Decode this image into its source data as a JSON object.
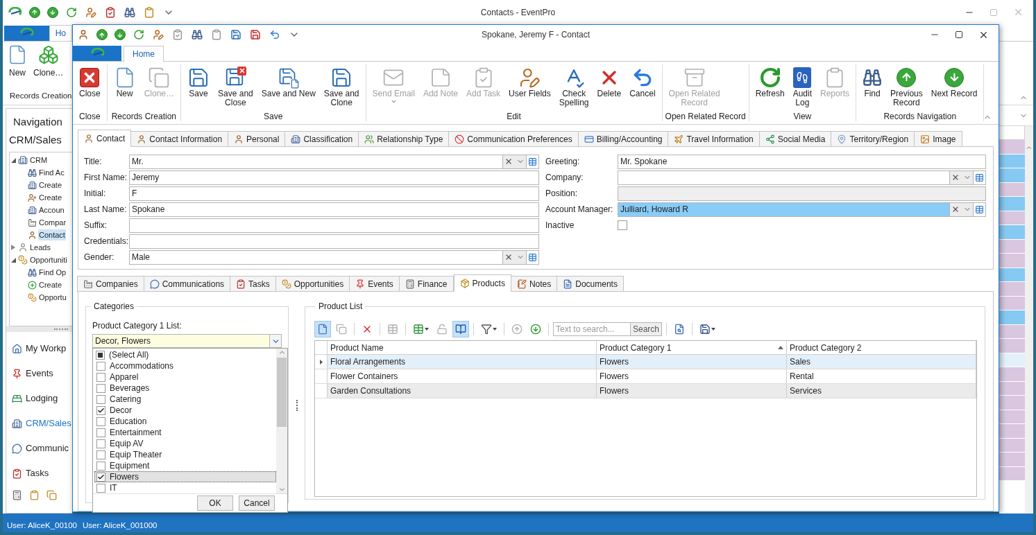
{
  "bg_window": {
    "title": "Contacts - EventPro",
    "tab": {
      "label": "Ho",
      "selected": true
    },
    "ribbon_buttons": [
      {
        "label": "New",
        "disabled": false
      },
      {
        "label": "Clone…",
        "disabled": false
      }
    ],
    "ribbon_group": "Records Creation",
    "navigation": {
      "title": "Navigation",
      "section": "CRM/Sales",
      "tree": [
        {
          "label": "CRM",
          "expanded": true,
          "selected": false,
          "children": [
            {
              "label": "Find Ac",
              "selected": false
            },
            {
              "label": "Create",
              "selected": false
            },
            {
              "label": "Create",
              "selected": false
            },
            {
              "label": "Accoun",
              "selected": false
            },
            {
              "label": "Compar",
              "selected": false
            },
            {
              "label": "Contact",
              "selected": true
            }
          ]
        },
        {
          "label": "Leads",
          "expanded": false,
          "selected": false
        },
        {
          "label": "Opportuniti",
          "expanded": true,
          "selected": false,
          "children": [
            {
              "label": "Find Op",
              "selected": false
            },
            {
              "label": "Create",
              "selected": false
            },
            {
              "label": "Opportu",
              "selected": false
            }
          ]
        }
      ]
    },
    "nav_buttons": [
      {
        "label": "My Workp",
        "selected": false
      },
      {
        "label": "Events",
        "selected": false
      },
      {
        "label": "Lodging",
        "selected": false
      },
      {
        "label": "CRM/Sales",
        "selected": true
      },
      {
        "label": "Communic",
        "selected": false
      },
      {
        "label": "Tasks",
        "selected": false
      }
    ],
    "status": [
      "User: AliceK_00100",
      "User: AliceK_001000"
    ],
    "grid_rows": [
      {
        "color": "#d9c6df"
      },
      {
        "color": "#86c9f3"
      },
      {
        "color": "#86c9f3"
      },
      {
        "color": "#d9c6df"
      },
      {
        "color": "#86c9f3"
      },
      {
        "color": "#d9c6df"
      },
      {
        "color": "#86c9f3"
      },
      {
        "color": "#d9c6df"
      },
      {
        "color": "#d9c6df"
      },
      {
        "color": "#86c9f3"
      },
      {
        "color": "#d9c6df"
      },
      {
        "color": "#d9c6df"
      },
      {
        "color": "#86c9f3"
      },
      {
        "color": "#d9c6df"
      },
      {
        "color": "#d9c6df"
      },
      {
        "color": "#e3f1fb"
      },
      {
        "color": "#d9c6df"
      },
      {
        "color": "#d9c6df"
      },
      {
        "color": "#d9c6df"
      },
      {
        "color": "#d9c6df"
      },
      {
        "color": "#d9c6df"
      },
      {
        "color": "#d9c6df"
      },
      {
        "color": "#d9c6df"
      },
      {
        "color": "#d9c6df"
      }
    ]
  },
  "dialog": {
    "title": "Spokane, Jeremy F - Contact",
    "ribbon_tabs": [
      {
        "label": "Home",
        "selected": true
      }
    ],
    "ribbon_groups": [
      {
        "label": "Close",
        "buttons": [
          {
            "label": "Close",
            "disabled": false,
            "menu": false
          }
        ]
      },
      {
        "label": "Records Creation",
        "buttons": [
          {
            "label": "New",
            "disabled": false,
            "menu": false
          },
          {
            "label": "Clone…",
            "disabled": true,
            "menu": false
          }
        ]
      },
      {
        "label": "Save",
        "buttons": [
          {
            "label": "Save",
            "disabled": false,
            "menu": false
          },
          {
            "label": "Save and\nClose",
            "disabled": false,
            "menu": false
          },
          {
            "label": "Save and New",
            "disabled": false,
            "menu": false
          },
          {
            "label": "Save and\nClone",
            "disabled": false,
            "menu": false
          }
        ]
      },
      {
        "label": "Edit",
        "buttons": [
          {
            "label": "Send Email",
            "disabled": true,
            "menu": true
          },
          {
            "label": "Add Note",
            "disabled": true,
            "menu": false
          },
          {
            "label": "Add Task",
            "disabled": true,
            "menu": false
          },
          {
            "label": "User Fields",
            "disabled": false,
            "menu": false
          },
          {
            "label": "Check\nSpelling",
            "disabled": false,
            "menu": false
          },
          {
            "label": "Delete",
            "disabled": false,
            "menu": false
          },
          {
            "label": "Cancel",
            "disabled": false,
            "menu": false
          }
        ]
      },
      {
        "label": "Open Related Record",
        "buttons": [
          {
            "label": "Open Related\nRecord",
            "disabled": true,
            "menu": false
          }
        ]
      },
      {
        "label": "View",
        "buttons": [
          {
            "label": "Refresh",
            "disabled": false,
            "menu": false
          },
          {
            "label": "Audit\nLog",
            "disabled": false,
            "menu": false
          },
          {
            "label": "Reports",
            "disabled": true,
            "menu": false
          }
        ]
      },
      {
        "label": "Records Navigation",
        "buttons": [
          {
            "label": "Find",
            "disabled": false,
            "menu": false
          },
          {
            "label": "Previous\nRecord",
            "disabled": false,
            "menu": false
          },
          {
            "label": "Next Record",
            "disabled": false,
            "menu": false
          }
        ]
      }
    ],
    "form_tabs": [
      {
        "label": "Contact",
        "selected": true
      },
      {
        "label": "Contact Information",
        "selected": false
      },
      {
        "label": "Personal",
        "selected": false
      },
      {
        "label": "Classification",
        "selected": false
      },
      {
        "label": "Relationship Type",
        "selected": false
      },
      {
        "label": "Communication Preferences",
        "selected": false
      },
      {
        "label": "Billing/Accounting",
        "selected": false
      },
      {
        "label": "Travel Information",
        "selected": false
      },
      {
        "label": "Social Media",
        "selected": false
      },
      {
        "label": "Territory/Region",
        "selected": false
      },
      {
        "label": "Image",
        "selected": false
      }
    ],
    "form": {
      "left": [
        {
          "label": "Title:",
          "kind": "combo",
          "value": "Mr.",
          "highlighted": false,
          "disabled": false
        },
        {
          "label": "First Name:",
          "kind": "text",
          "value": "Jeremy",
          "highlighted": false,
          "disabled": false
        },
        {
          "label": "Initial:",
          "kind": "text",
          "value": "F",
          "highlighted": false,
          "disabled": false
        },
        {
          "label": "Last Name:",
          "kind": "text",
          "value": "Spokane",
          "highlighted": false,
          "disabled": false
        },
        {
          "label": "Suffix:",
          "kind": "text",
          "highlighted": false,
          "disabled": false
        },
        {
          "label": "Credentials:",
          "kind": "text",
          "highlighted": false,
          "disabled": false
        },
        {
          "label": "Gender:",
          "kind": "combo",
          "value": "Male",
          "highlighted": false,
          "disabled": false
        }
      ],
      "right": [
        {
          "label": "Greeting:",
          "kind": "text",
          "value": "Mr. Spokane",
          "highlighted": false,
          "disabled": false
        },
        {
          "label": "Company:",
          "kind": "combo",
          "highlighted": false,
          "disabled": false
        },
        {
          "label": "Position:",
          "kind": "text",
          "highlighted": false,
          "disabled": true
        },
        {
          "label": "Account Manager:",
          "kind": "combo",
          "value": "Julliard, Howard R",
          "highlighted": true,
          "disabled": false
        },
        {
          "label": "Inactive",
          "kind": "checkbox",
          "checked": false
        }
      ]
    },
    "detail_tabs": [
      {
        "label": "Companies",
        "selected": false
      },
      {
        "label": "Communications",
        "selected": false
      },
      {
        "label": "Tasks",
        "selected": false
      },
      {
        "label": "Opportunities",
        "selected": false
      },
      {
        "label": "Events",
        "selected": false
      },
      {
        "label": "Finance",
        "selected": false
      },
      {
        "label": "Products",
        "selected": true
      },
      {
        "label": "Notes",
        "selected": false
      },
      {
        "label": "Documents",
        "selected": false
      }
    ],
    "categories": {
      "title": "Categories",
      "list_label": "Product Category 1 List:",
      "value": "Decor, Flowers",
      "select_all": {
        "label": "(Select All)",
        "checked": false,
        "indeterminate": true
      },
      "items": [
        {
          "label": "Accommodations",
          "checked": false,
          "selected": false
        },
        {
          "label": "Apparel",
          "checked": false,
          "selected": false
        },
        {
          "label": "Beverages",
          "checked": false,
          "selected": false
        },
        {
          "label": "Catering",
          "checked": false,
          "selected": false
        },
        {
          "label": "Decor",
          "checked": true,
          "selected": false
        },
        {
          "label": "Education",
          "checked": false,
          "selected": false
        },
        {
          "label": "Entertainment",
          "checked": false,
          "selected": false
        },
        {
          "label": "Equip AV",
          "checked": false,
          "selected": false
        },
        {
          "label": "Equip Theater",
          "checked": false,
          "selected": false
        },
        {
          "label": "Equipment",
          "checked": false,
          "selected": false
        },
        {
          "label": "Flowers",
          "checked": true,
          "selected": true
        },
        {
          "label": "IT",
          "checked": false,
          "selected": false
        }
      ],
      "buttons": [
        "OK",
        "Cancel"
      ]
    },
    "product_list": {
      "title": "Product List",
      "toolbar": [
        {
          "kind": "button",
          "pressed": true,
          "disabled": false,
          "menu": false
        },
        {
          "kind": "button",
          "pressed": false,
          "disabled": true,
          "menu": false
        },
        {
          "kind": "separator"
        },
        {
          "kind": "button",
          "pressed": false,
          "disabled": false,
          "menu": false
        },
        {
          "kind": "separator"
        },
        {
          "kind": "button",
          "pressed": false,
          "disabled": true,
          "menu": false
        },
        {
          "kind": "separator"
        },
        {
          "kind": "button",
          "pressed": false,
          "disabled": false,
          "menu": true
        },
        {
          "kind": "button",
          "pressed": false,
          "disabled": true,
          "menu": false
        },
        {
          "kind": "button",
          "pressed": true,
          "disabled": false,
          "menu": false
        },
        {
          "kind": "separator"
        },
        {
          "kind": "button",
          "pressed": false,
          "disabled": false,
          "menu": true
        },
        {
          "kind": "separator"
        },
        {
          "kind": "button",
          "pressed": false,
          "disabled": true,
          "menu": false
        },
        {
          "kind": "button",
          "pressed": false,
          "disabled": false,
          "menu": false
        },
        {
          "kind": "separator"
        },
        {
          "kind": "search",
          "placeholder": "Text to search...",
          "button": "Search"
        },
        {
          "kind": "separator"
        },
        {
          "kind": "button",
          "pressed": false,
          "disabled": false,
          "menu": false
        },
        {
          "kind": "separator"
        },
        {
          "kind": "button",
          "pressed": false,
          "disabled": false,
          "menu": true
        }
      ],
      "columns": [
        {
          "label": "Product Name",
          "sorted_ascending": false
        },
        {
          "label": "Product Category 1",
          "sorted_ascending": true
        },
        {
          "label": "Product Category 2",
          "sorted_ascending": false
        }
      ],
      "rows": [
        {
          "cells": [
            "Floral Arrangements",
            "Flowers",
            "Sales"
          ],
          "selected": true,
          "shaded": false
        },
        {
          "cells": [
            "Flower Containers",
            "Flowers",
            "Rental"
          ],
          "selected": false,
          "shaded": false
        },
        {
          "cells": [
            "Garden Consultations",
            "Flowers",
            "Services"
          ],
          "selected": false,
          "shaded": true
        }
      ]
    }
  }
}
